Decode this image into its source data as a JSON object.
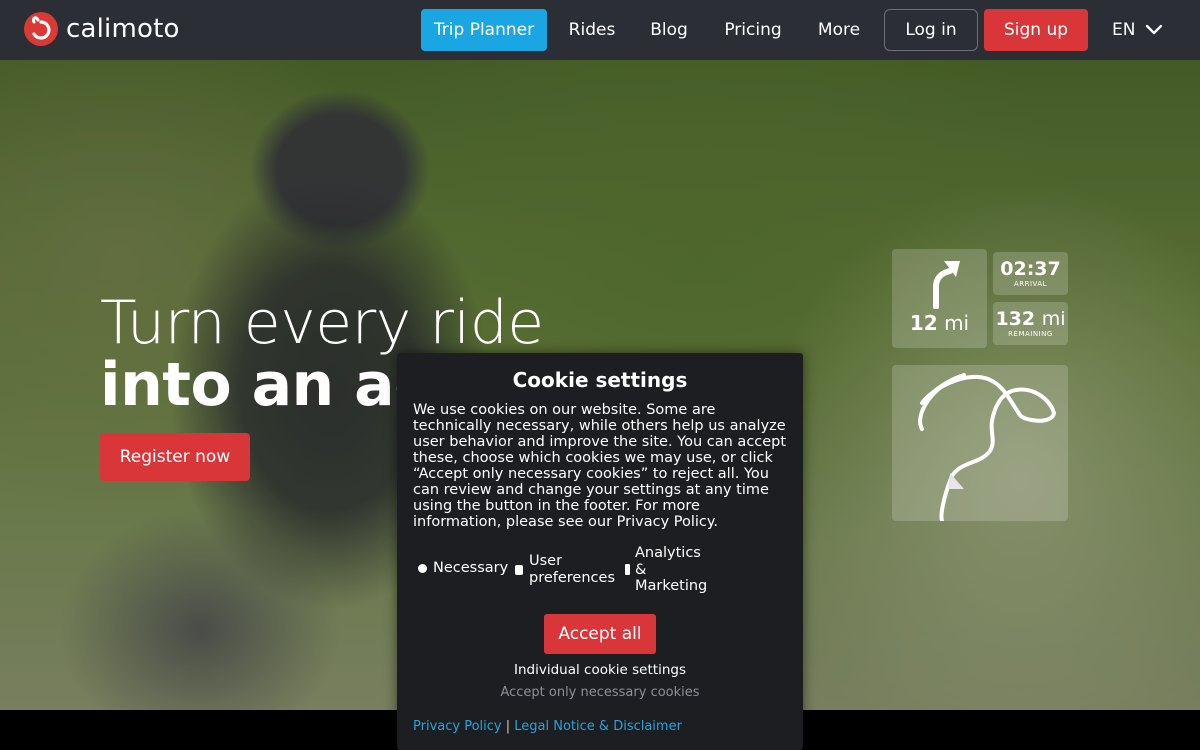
{
  "nav": {
    "brand": "calimoto",
    "items": [
      {
        "label": "Trip Planner"
      },
      {
        "label": "Rides"
      },
      {
        "label": "Blog"
      },
      {
        "label": "Pricing"
      },
      {
        "label": "More"
      }
    ],
    "login": "Log in",
    "signup": "Sign up",
    "language": "EN"
  },
  "hero": {
    "title_line1": "Turn every ride",
    "title_line2": "into an adv",
    "cta": "Register now"
  },
  "nav_widget": {
    "turn_distance_value": "12",
    "turn_distance_unit": "mi",
    "arrival_time": "02:37",
    "arrival_label": "ARRIVAL",
    "remaining_value": "132",
    "remaining_unit": "mi",
    "remaining_label": "REMAINING"
  },
  "cookie": {
    "title": "Cookie settings",
    "body": "We use cookies on our website. Some are technically necessary, while others help us analyze user behavior and improve the site. You can accept these, choose which cookies we may use, or click “Accept only necessary cookies” to reject all. You can review and change your settings at any time using the button in the footer. For more information, please see our Privacy Policy.",
    "options": [
      {
        "label": "Necessary"
      },
      {
        "label": "User preferences"
      },
      {
        "label": "Analytics & Marketing"
      }
    ],
    "accept_all": "Accept all",
    "individual": "Individual cookie settings",
    "only_necessary": "Accept only necessary cookies",
    "privacy_link": "Privacy Policy",
    "separator": "|",
    "legal_link": "Legal Notice & Disclaimer"
  },
  "colors": {
    "nav_bg": "#2b2f35",
    "accent_blue": "#1aa6e3",
    "accent_red": "#d9363a",
    "modal_bg": "#1c1e22",
    "link_blue": "#28a3dc"
  }
}
